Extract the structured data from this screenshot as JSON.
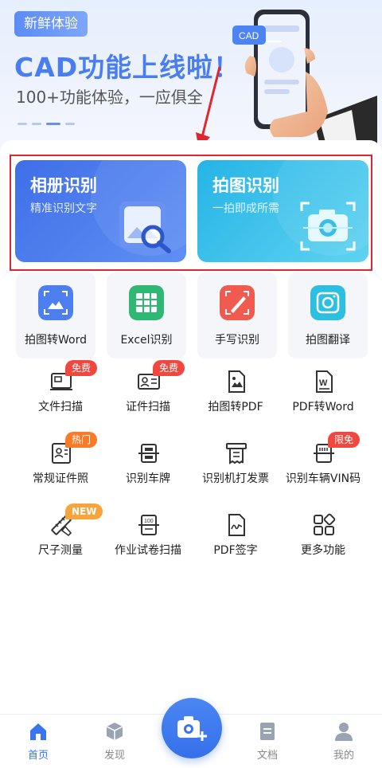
{
  "banner": {
    "badge": "新鲜体验",
    "title": "CAD功能上线啦！",
    "subtitle": "100+功能体验，一应俱全",
    "phone_tag": "CAD"
  },
  "main_cards": [
    {
      "title": "相册识别",
      "subtitle": "精准识别文字"
    },
    {
      "title": "拍图识别",
      "subtitle": "一拍即成所需"
    }
  ],
  "quick_tools": [
    {
      "label": "拍图转Word",
      "icon": "photo-to-word-icon",
      "color": "#4d7ff0"
    },
    {
      "label": "Excel识别",
      "icon": "excel-icon",
      "color": "#2fb874"
    },
    {
      "label": "手写识别",
      "icon": "handwriting-icon",
      "color": "#f05a4f"
    },
    {
      "label": "拍图翻译",
      "icon": "translate-icon",
      "color": "#2cbfe0"
    }
  ],
  "tools": [
    {
      "label": "文件扫描",
      "tag": "免费"
    },
    {
      "label": "证件扫描",
      "tag": "免费"
    },
    {
      "label": "拍图转PDF",
      "tag": ""
    },
    {
      "label": "PDF转Word",
      "tag": ""
    },
    {
      "label": "常规证件照",
      "tag": "热门"
    },
    {
      "label": "识别车牌",
      "tag": ""
    },
    {
      "label": "识别机打发票",
      "tag": ""
    },
    {
      "label": "识别车辆VIN码",
      "tag": "限免"
    },
    {
      "label": "尺子测量",
      "tag": "NEW"
    },
    {
      "label": "作业试卷扫描",
      "tag": ""
    },
    {
      "label": "PDF签字",
      "tag": ""
    },
    {
      "label": "更多功能",
      "tag": ""
    }
  ],
  "nav": {
    "items": [
      {
        "label": "首页"
      },
      {
        "label": "发现"
      },
      {
        "label": "文档"
      },
      {
        "label": "我的"
      }
    ]
  },
  "colors": {
    "accent": "#3a74ef",
    "highlight_border": "#e0272f"
  }
}
